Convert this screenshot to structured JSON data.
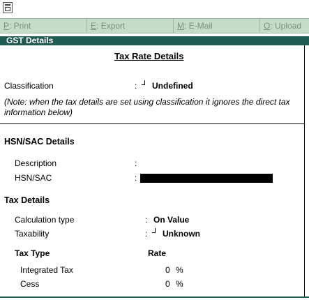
{
  "toolbar": {
    "print": {
      "key": "P",
      "label": ": Print"
    },
    "export": {
      "key": "E",
      "label": ": Export"
    },
    "email": {
      "key": "M",
      "label": ": E-Mail"
    },
    "upload": {
      "key": "O",
      "label": ": Upload"
    }
  },
  "panel": {
    "header": "GST Details",
    "title": "Tax Rate Details",
    "classification": {
      "label": "Classification",
      "value": "Undefined"
    },
    "note": "(Note: when the tax details are set using classification it ignores the direct tax information below)",
    "hsn": {
      "title": "HSN/SAC Details",
      "description_label": "Description",
      "hsn_label": "HSN/SAC"
    },
    "tax": {
      "title": "Tax Details",
      "calc_label": "Calculation type",
      "calc_value": "On Value",
      "taxability_label": "Taxability",
      "taxability_value": "Unknown",
      "type_header": "Tax Type",
      "rate_header": "Rate",
      "rows": [
        {
          "name": "Integrated Tax",
          "rate": "0",
          "unit": "%"
        },
        {
          "name": "Cess",
          "rate": "0",
          "unit": "%"
        }
      ]
    },
    "colon": ":"
  }
}
